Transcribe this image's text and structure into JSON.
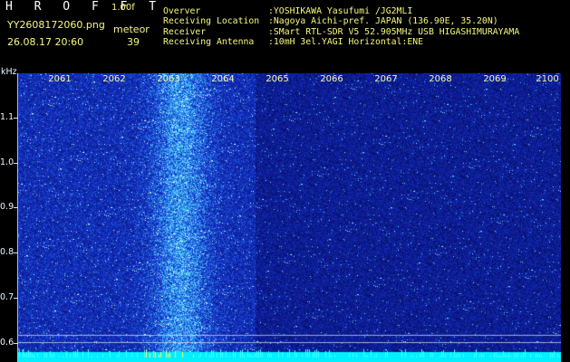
{
  "header": {
    "app_title": "H R O F F T",
    "version": "1.00f",
    "file_name": "YY2608172060.png",
    "datetime": "26.08.17 20:60",
    "meteor_label": "meteor",
    "meteor_count": "39"
  },
  "meta": [
    {
      "key": "Overver",
      "value": ":YOSHIKAWA Yasufumi /JG2MLI"
    },
    {
      "key": "Receiving Location",
      "value": ":Nagoya Aichi-pref. JAPAN (136.90E, 35.20N)"
    },
    {
      "key": "Receiver",
      "value": ":SMart RTL-SDR V5 52.905MHz USB HIGASHIMURAYAMA"
    },
    {
      "key": "Receiving Antenna",
      "value": ":10mH 3el.YAGI Horizontal:ENE"
    }
  ],
  "axis": {
    "y_unit": "kHz",
    "x_labels": [
      "2061",
      "2062",
      "2063",
      "2064",
      "2065",
      "2066",
      "2067",
      "2068",
      "2069",
      "2100"
    ],
    "y_labels": [
      "1.1",
      "1.0",
      "0.9",
      "0.8",
      "0.7",
      "0.6"
    ]
  },
  "colors": {
    "background": "#000000",
    "waterfall_low": "#0b18b8",
    "waterfall_mid": "#2c6cff",
    "waterfall_high": "#7ff8ff",
    "header_text": "#f7f77e",
    "baseline": "#00ffff"
  }
}
